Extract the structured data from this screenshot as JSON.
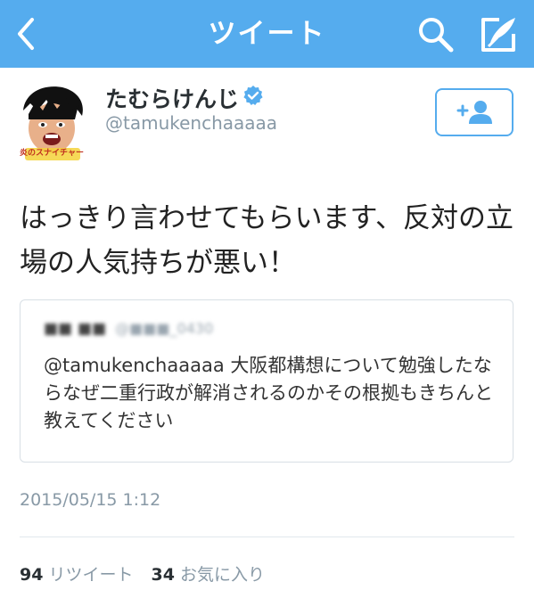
{
  "colors": {
    "brand": "#55acee",
    "verified": "#55acee"
  },
  "nav": {
    "title": "ツイート",
    "back_icon": "chevron-left-icon",
    "search_icon": "search-icon",
    "compose_icon": "compose-icon"
  },
  "author": {
    "name": "たむらけんじ",
    "handle": "@tamukenchaaaaa",
    "verified": true,
    "avatar_caption": "炎のスナイチャー"
  },
  "follow_button": {
    "icon": "add-user-icon"
  },
  "tweet": {
    "text": "はっきり言わせてもらいます、反対の立場の人気持ちが悪い！"
  },
  "quoted_tweet": {
    "author_name": "■■ ■■",
    "author_handle": "@■■■_0430",
    "text": "@tamukenchaaaaa 大阪都構想について勉強したならなぜ二重行政が解消されるのかその根拠もきちんと教えてください"
  },
  "timestamp": "2015/05/15 1:12",
  "stats": {
    "retweets": {
      "count": "94",
      "label": "リツイート"
    },
    "favorites": {
      "count": "34",
      "label": "お気に入り"
    }
  }
}
